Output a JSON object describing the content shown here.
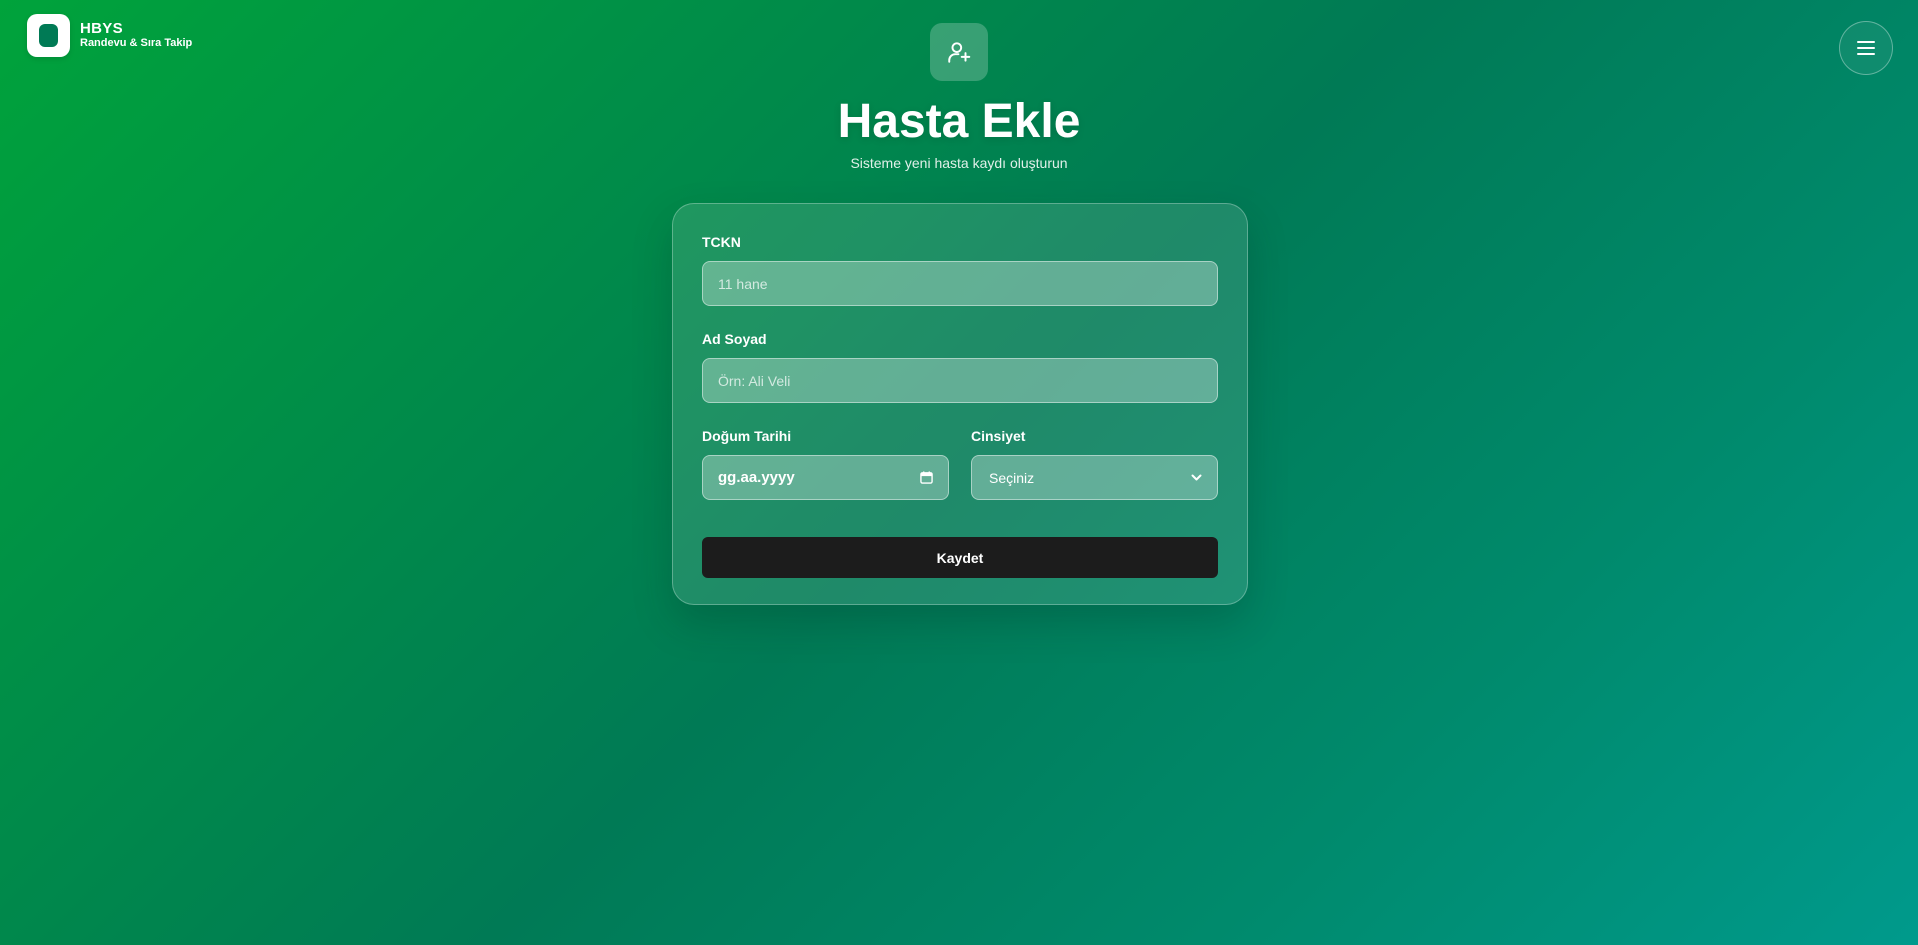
{
  "brand": {
    "title": "HBYS",
    "subtitle": "Randevu & Sıra Takip",
    "logo_icon": "app-logo-icon"
  },
  "header": {
    "icon": "user-plus-icon",
    "title": "Hasta Ekle",
    "subtitle": "Sisteme yeni hasta kaydı oluşturun"
  },
  "menu": {
    "icon": "hamburger-menu-icon"
  },
  "form": {
    "tckn": {
      "label": "TCKN",
      "placeholder": "11 hane",
      "value": ""
    },
    "name": {
      "label": "Ad Soyad",
      "placeholder": "Örn: Ali Veli",
      "value": ""
    },
    "birthdate": {
      "label": "Doğum Tarihi",
      "display": "gg.aa.yyyy",
      "icon": "calendar-icon"
    },
    "gender": {
      "label": "Cinsiyet",
      "selected": "Seçiniz",
      "icon": "chevron-down-icon"
    },
    "submit_label": "Kaydet"
  },
  "colors": {
    "gradient_start": "#00a33b",
    "gradient_end": "#009a8c",
    "button_bg": "#1c1c1c",
    "logo_inner": "#007a55"
  }
}
